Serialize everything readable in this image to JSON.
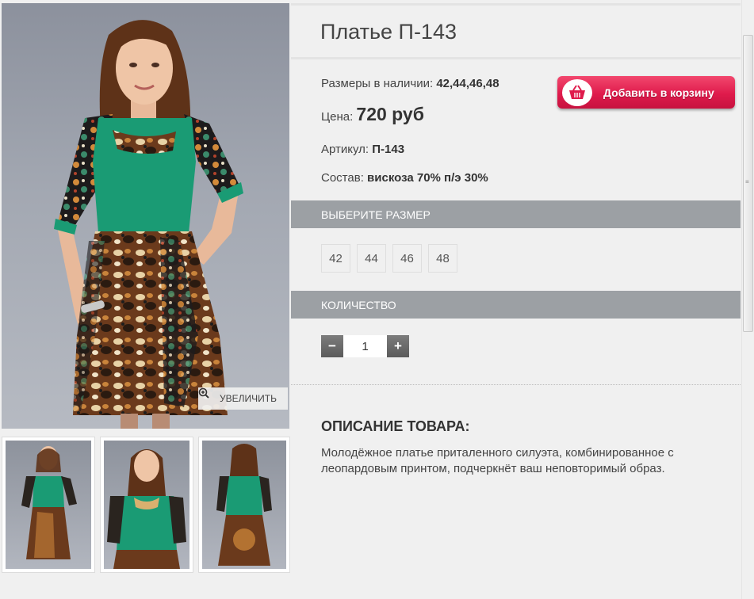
{
  "product": {
    "title": "Платье П-143",
    "sizes_label": "Размеры в наличии:",
    "sizes_value": "42,44,46,48",
    "price_label": "Цена:",
    "price_value": "720 руб",
    "article_label": "Артикул:",
    "article_value": "П-143",
    "composition_label": "Состав:",
    "composition_value": "вискоза 70% п/э 30%"
  },
  "cart_button": {
    "label": "Добавить в корзину",
    "icon": "basket-icon"
  },
  "gallery": {
    "zoom_label": "УВЕЛИЧИТЬ",
    "zoom_icon": "magnifier-plus-icon",
    "thumb_count": 3
  },
  "size_section": {
    "header": "ВЫБЕРИТЕ РАЗМЕР",
    "options": [
      "42",
      "44",
      "46",
      "48"
    ]
  },
  "quantity_section": {
    "header": "КОЛИЧЕСТВО",
    "minus_label": "−",
    "plus_label": "+",
    "value": "1"
  },
  "description": {
    "title": "ОПИСАНИЕ ТОВАРА:",
    "text": "Молодёжное платье приталенного силуэта, комбинированное с леопардовым принтом, подчеркнёт ваш неповторимый образ."
  },
  "colors": {
    "accent_button": "#df1b4c",
    "section_bar": "#9ca0a4",
    "dress_green": "#1a9b74",
    "page_bg": "#f0f0f0"
  }
}
